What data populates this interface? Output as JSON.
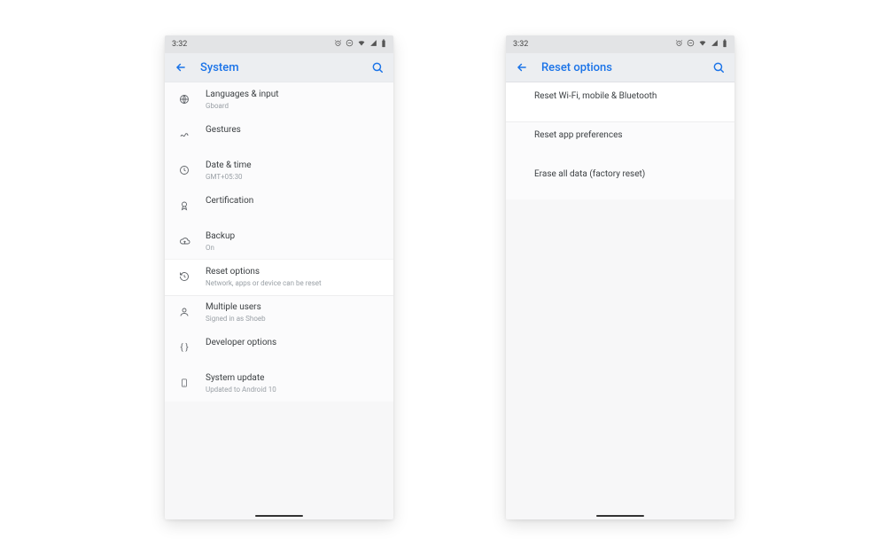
{
  "statusbar": {
    "time": "3:32"
  },
  "left": {
    "title": "System",
    "rows": [
      {
        "icon": "globe",
        "label": "Languages & input",
        "sub": "Gboard"
      },
      {
        "icon": "gesture",
        "label": "Gestures"
      },
      {
        "icon": "clock",
        "label": "Date & time",
        "sub": "GMT+05:30"
      },
      {
        "icon": "ribbon",
        "label": "Certification"
      },
      {
        "icon": "cloud",
        "label": "Backup",
        "sub": "On"
      },
      {
        "icon": "history",
        "label": "Reset options",
        "sub": "Network, apps or device can be reset",
        "highlight": true
      },
      {
        "icon": "user",
        "label": "Multiple users",
        "sub": "Signed in as Shoeb"
      },
      {
        "icon": "braces",
        "label": "Developer options"
      },
      {
        "icon": "phone",
        "label": "System update",
        "sub": "Updated to Android 10"
      }
    ]
  },
  "right": {
    "title": "Reset options",
    "rows": [
      {
        "label": "Reset Wi-Fi, mobile & Bluetooth",
        "highlight": true
      },
      {
        "label": "Reset app preferences"
      },
      {
        "label": "Erase all data (factory reset)"
      }
    ]
  }
}
